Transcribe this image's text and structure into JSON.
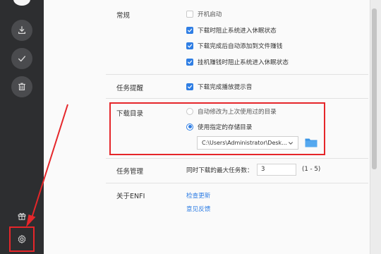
{
  "sidebar": {
    "items": [
      {
        "icon": "download-icon"
      },
      {
        "icon": "check-icon"
      },
      {
        "icon": "trash-icon"
      }
    ],
    "gift_icon": "gift-icon",
    "settings_icon": "gear-icon"
  },
  "settings": {
    "general": {
      "label": "常规",
      "options": [
        {
          "text": "开机启动",
          "checked": false
        },
        {
          "text": "下载时阻止系统进入休眠状态",
          "checked": true
        },
        {
          "text": "下载完成后自动添加到文件赚钱",
          "checked": true
        },
        {
          "text": "挂机赚钱时阻止系统进入休眠状态",
          "checked": true
        }
      ]
    },
    "task_reminder": {
      "label": "任务提醒",
      "option": {
        "text": "下载完成播放提示音",
        "checked": true
      }
    },
    "download_dir": {
      "label": "下载目录",
      "radios": [
        {
          "text": "自动修改为上次使用过的目录",
          "selected": false
        },
        {
          "text": "使用指定的存储目录",
          "selected": true
        }
      ],
      "path_value": "C:\\Users\\Administrator\\Desk..."
    },
    "task_manage": {
      "label": "任务管理",
      "max_tasks_label": "同时下载的最大任务数：",
      "max_tasks_value": "3",
      "range": "(1 - 5)"
    },
    "about": {
      "label": "关于ENFI",
      "check_update": "检查更新",
      "feedback": "意见反馈"
    }
  },
  "colors": {
    "accent": "#2f7ee4",
    "annotation": "#e5262a",
    "sidebar_bg": "#2d2e30"
  }
}
